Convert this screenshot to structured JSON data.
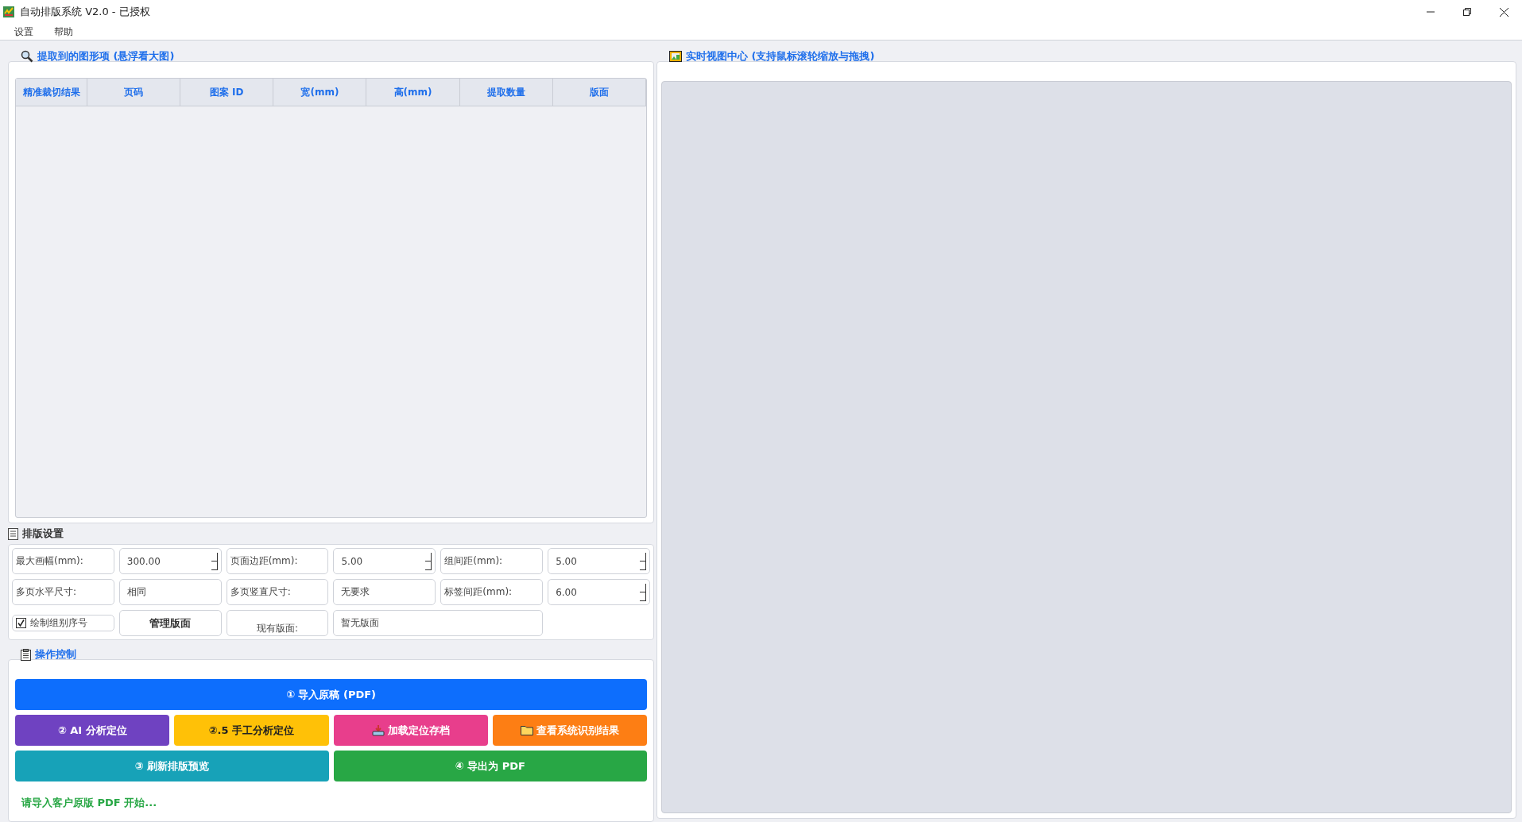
{
  "window": {
    "title": "自动排版系统 V2.0 - 已授权"
  },
  "menu": [
    {
      "label": "设置"
    },
    {
      "label": "帮助"
    }
  ],
  "extracted": {
    "title": "提取到的图形项 (悬浮看大图)",
    "columns": [
      "精准裁切结果",
      "页码",
      "图案 ID",
      "宽(mm)",
      "高(mm)",
      "提取数量",
      "版面"
    ]
  },
  "settings": {
    "title": "排版设置",
    "rows": [
      [
        {
          "kind": "label",
          "text": "最大画幅(mm):"
        },
        {
          "kind": "spin",
          "value": "300.00"
        },
        {
          "kind": "label",
          "text": "页面边距(mm):"
        },
        {
          "kind": "spin",
          "value": "5.00"
        },
        {
          "kind": "label",
          "text": "组间距(mm):"
        },
        {
          "kind": "spin",
          "value": "5.00"
        }
      ],
      [
        {
          "kind": "label",
          "text": "多页水平尺寸:"
        },
        {
          "kind": "combo",
          "value": "相同"
        },
        {
          "kind": "label",
          "text": "多页竖直尺寸:"
        },
        {
          "kind": "combo",
          "value": "无要求"
        },
        {
          "kind": "label",
          "text": "标签间距(mm):"
        },
        {
          "kind": "spin",
          "value": "6.00"
        }
      ],
      [
        {
          "kind": "checkbox",
          "text": "绘制组别序号",
          "checked": true
        },
        {
          "kind": "button",
          "text": "管理版面"
        },
        {
          "kind": "label-right",
          "text": "现有版面:"
        },
        {
          "kind": "wide",
          "value": "暂无版面"
        }
      ]
    ]
  },
  "operations": {
    "title": "操作控制",
    "rows": [
      [
        {
          "label": "① 导入原稿 (PDF)",
          "color": "#0d6efd",
          "kind": "plain"
        }
      ],
      [
        {
          "label": "② AI 分析定位",
          "color": "#6f42c1",
          "kind": "plain"
        },
        {
          "label": "②.5 手工分析定位",
          "color": "#ffc107",
          "kind": "plain"
        },
        {
          "label": "加载定位存档",
          "color": "#e83e8c",
          "kind": "tray"
        },
        {
          "label": "查看系统识别结果",
          "color": "#fd7e14",
          "kind": "folder"
        }
      ],
      [
        {
          "label": "③ 刷新排版预览",
          "color": "#17a2b8",
          "kind": "plain"
        },
        {
          "label": "④ 导出为 PDF",
          "color": "#28a745",
          "kind": "plain"
        }
      ]
    ],
    "status": "请导入客户原版 PDF 开始..."
  },
  "view": {
    "title": "实时视图中心 (支持鼠标滚轮缩放与拖拽)"
  }
}
